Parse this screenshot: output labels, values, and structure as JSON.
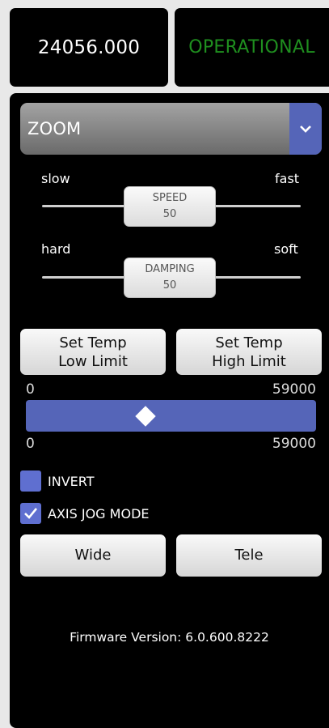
{
  "header": {
    "position_value": "24056.000",
    "status": "OPERATIONAL"
  },
  "mode_select": {
    "selected": "ZOOM"
  },
  "speed_slider": {
    "left_label": "slow",
    "right_label": "fast",
    "thumb_label": "SPEED",
    "value": "50"
  },
  "damping_slider": {
    "left_label": "hard",
    "right_label": "soft",
    "thumb_label": "DAMPING",
    "value": "50"
  },
  "temp_buttons": {
    "low_line1": "Set Temp",
    "low_line2": "Low Limit",
    "high_line1": "Set Temp",
    "high_line2": "High Limit"
  },
  "range": {
    "top_min": "0",
    "top_max": "59000",
    "bottom_min": "0",
    "bottom_max": "59000"
  },
  "options": {
    "invert_label": "INVERT",
    "invert_checked": false,
    "axis_jog_label": "AXIS JOG MODE",
    "axis_jog_checked": true
  },
  "zoom_buttons": {
    "wide": "Wide",
    "tele": "Tele"
  },
  "footer": {
    "firmware": "Firmware Version: 6.0.600.8222"
  },
  "colors": {
    "accent": "#5565b8",
    "status_ok": "#1f8f1f",
    "checkbox": "#5f6fd0"
  },
  "icons": {
    "select_arrow": "chevron-down-icon",
    "checkbox_check": "checkmark-icon"
  }
}
